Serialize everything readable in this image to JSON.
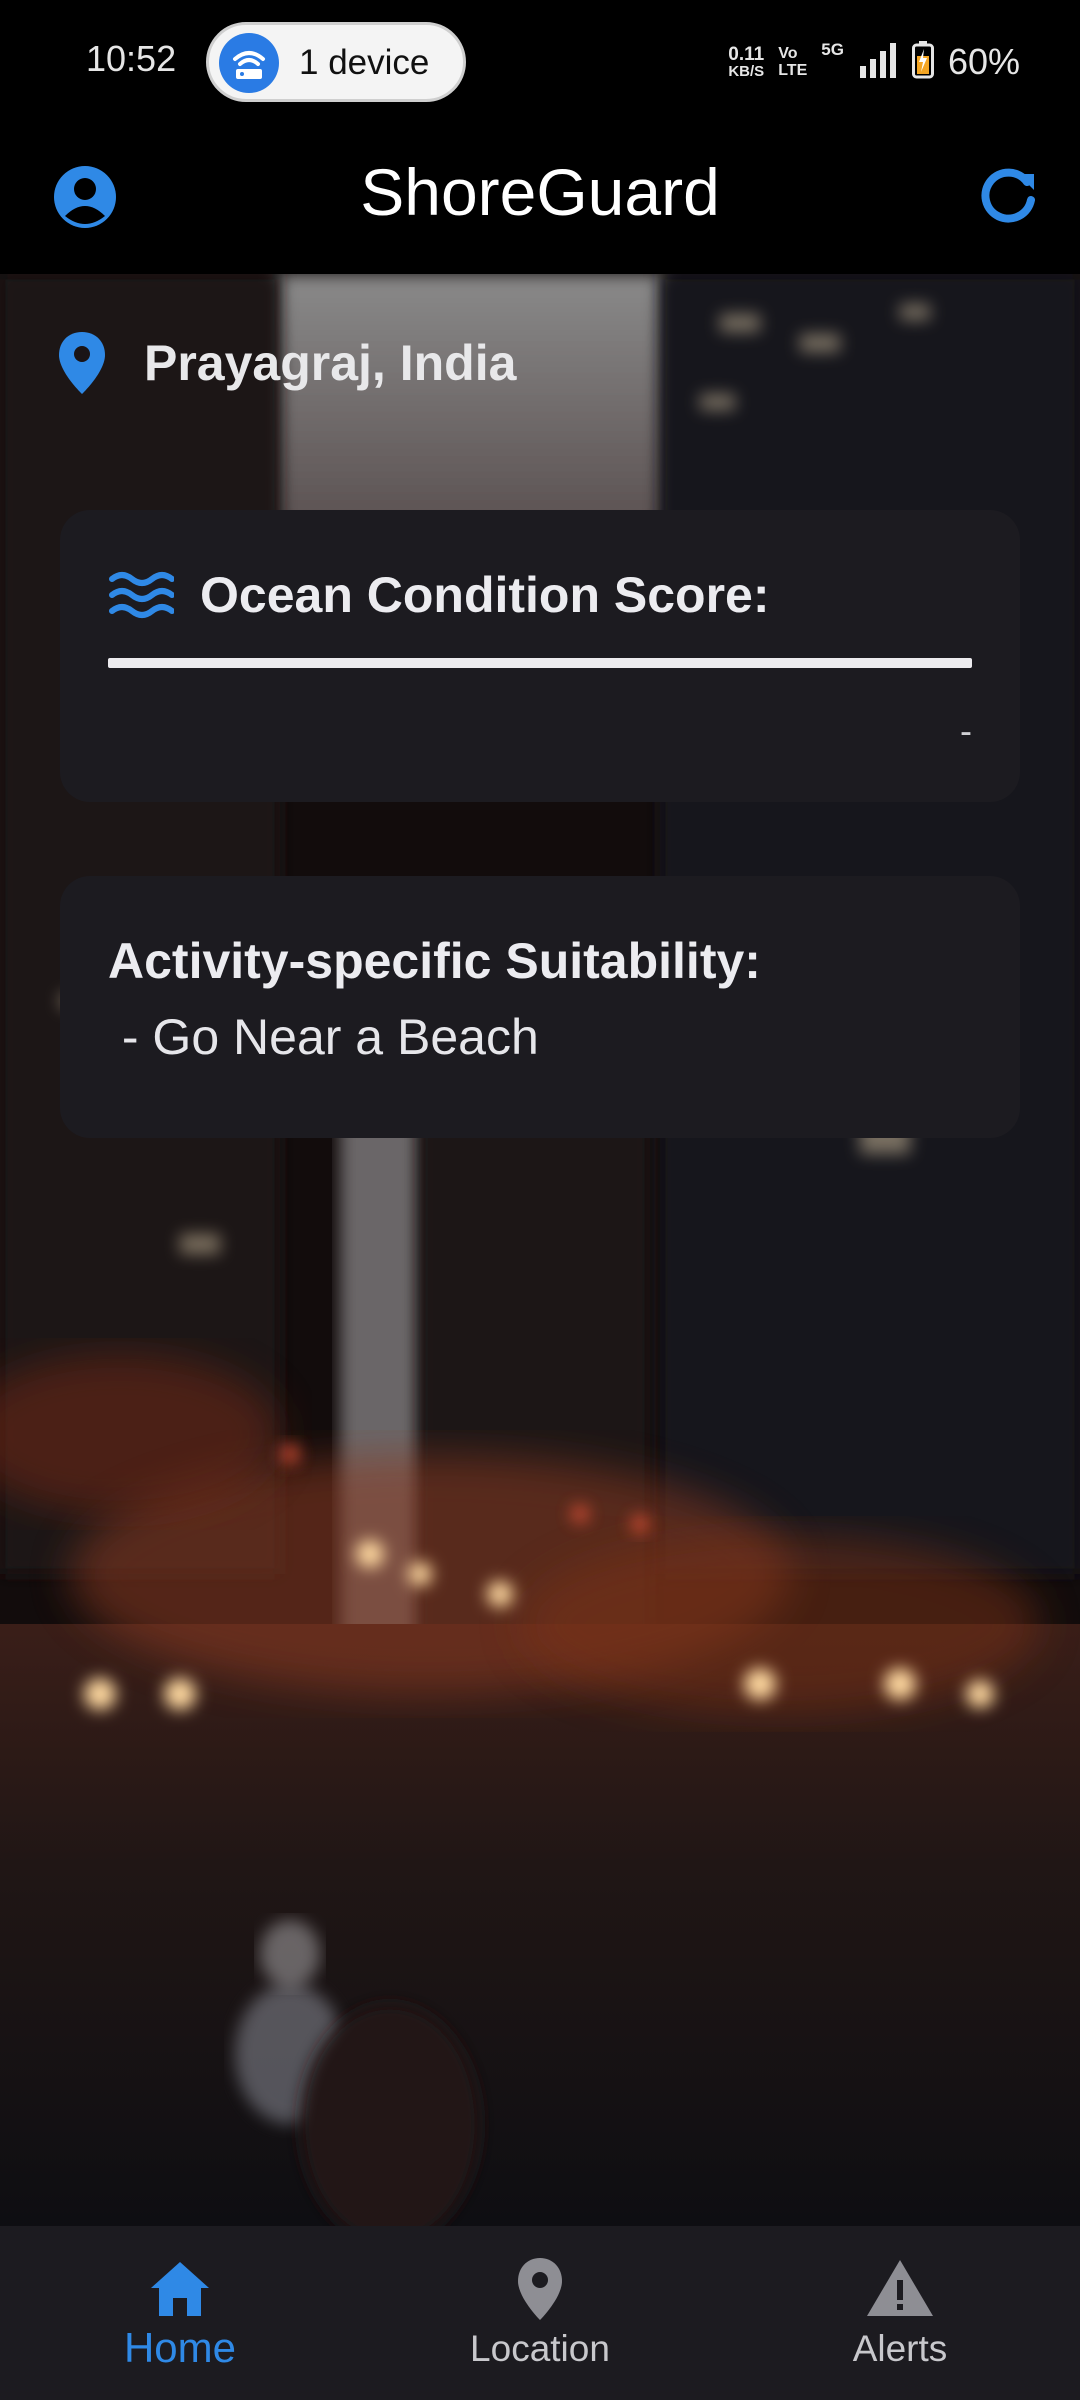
{
  "status_bar": {
    "time": "10:52",
    "hotspot_label": "1 device",
    "net_speed_value": "0.11",
    "net_speed_unit": "KB/S",
    "volte_top": "Vo",
    "volte_bottom": "LTE",
    "network_type": "5G",
    "battery_percent": "60%"
  },
  "app_bar": {
    "title": "ShoreGuard",
    "left_icon": "account-circle-icon",
    "right_icon": "refresh-icon"
  },
  "location": {
    "icon": "location-pin-icon",
    "name": "Prayagraj, India"
  },
  "ocean_score": {
    "icon": "waves-icon",
    "title": "Ocean Condition Score:",
    "progress_fraction": 1.0,
    "value": "-"
  },
  "activity": {
    "title": "Activity-specific Suitability:",
    "item": " - Go Near a Beach"
  },
  "bottom_nav": {
    "items": [
      {
        "label": "Home",
        "icon": "home-icon",
        "active": true
      },
      {
        "label": "Location",
        "icon": "location-pin-icon",
        "active": false
      },
      {
        "label": "Alerts",
        "icon": "warning-icon",
        "active": false
      }
    ]
  },
  "colors": {
    "accent": "#2f89e6",
    "card_background": "#1c1b20",
    "app_background": "#000000",
    "nav_background": "#1c1b20"
  }
}
